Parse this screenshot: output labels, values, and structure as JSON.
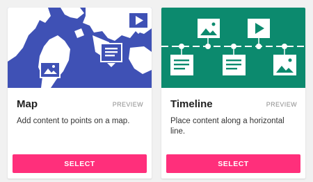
{
  "cards": [
    {
      "title": "Map",
      "preview_label": "PREVIEW",
      "description": "Add content to points on a map.",
      "select_label": "SELECT",
      "media_color": "#3f51b5"
    },
    {
      "title": "Timeline",
      "preview_label": "PREVIEW",
      "description": "Place content along a horizontal line.",
      "select_label": "SELECT",
      "media_color": "#0c8a6e"
    }
  ],
  "colors": {
    "select_button": "#ff2f7b",
    "page_background": "#f1f1f1"
  },
  "icons": {
    "map_media": [
      "world-map-icon",
      "image-marker-icon",
      "video-marker-icon",
      "text-marker-icon"
    ],
    "timeline_media": [
      "timeline-line-icon",
      "image-card-icon",
      "video-card-icon",
      "text-card-icon"
    ]
  }
}
